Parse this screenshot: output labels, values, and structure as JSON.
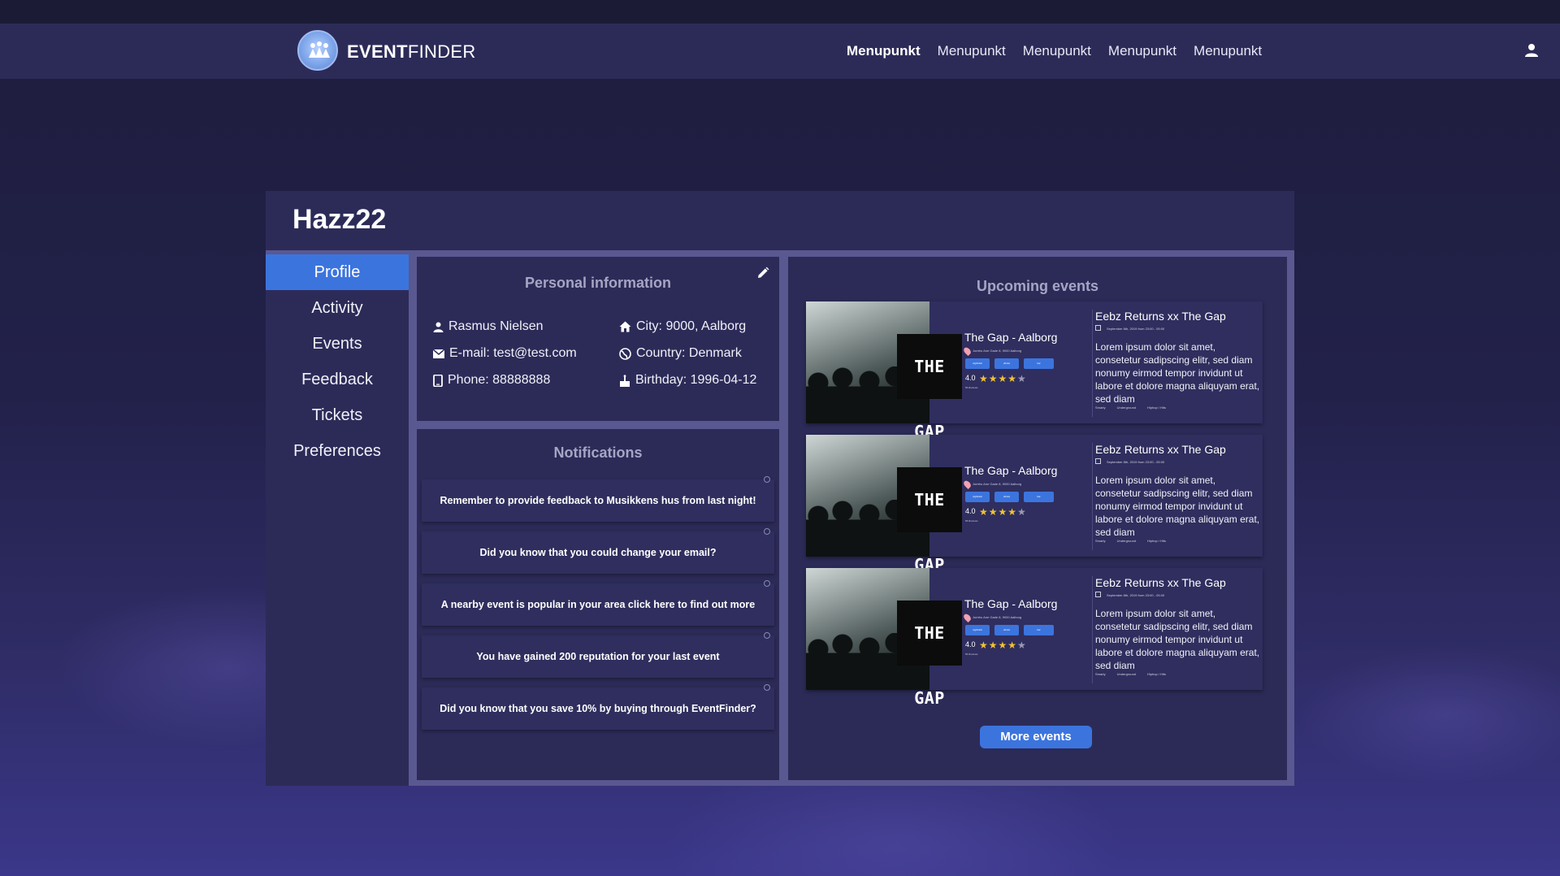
{
  "brand": {
    "bold": "EVENT",
    "light": "FINDER",
    "logo_icon": "people-icon"
  },
  "nav": {
    "items": [
      {
        "label": "Menupunkt",
        "active": true
      },
      {
        "label": "Menupunkt",
        "active": false
      },
      {
        "label": "Menupunkt",
        "active": false
      },
      {
        "label": "Menupunkt",
        "active": false
      },
      {
        "label": "Menupunkt",
        "active": false
      }
    ],
    "user_icon": "user-icon"
  },
  "profile": {
    "username": "Hazz22"
  },
  "sidebar": {
    "items": [
      {
        "label": "Profile",
        "active": true
      },
      {
        "label": "Activity",
        "active": false
      },
      {
        "label": "Events",
        "active": false
      },
      {
        "label": "Feedback",
        "active": false
      },
      {
        "label": "Tickets",
        "active": false
      },
      {
        "label": "Preferences",
        "active": false
      }
    ]
  },
  "personal": {
    "title": "Personal information",
    "name": "Rasmus Nielsen",
    "email": "E-mail: test@test.com",
    "phone": "Phone: 88888888",
    "city": "City: 9000, Aalborg",
    "country": "Country: Denmark",
    "birthday": "Birthday: 1996-04-12"
  },
  "notifications": {
    "title": "Notifications",
    "items": [
      "Remember to provide feedback to Musikkens hus from last night!",
      "Did you know that you could change your email?",
      "A nearby event is popular in your area click here to find out more",
      "You have gained 200 reputation for your last event",
      "Did you know that you save 10% by buying through EventFinder?"
    ]
  },
  "upcoming": {
    "title": "Upcoming events",
    "events": [
      {
        "venue": "The Gap - Aalborg",
        "logo_text": "THE GAP",
        "address": "Jomfru Ane Gade 8, 9000 Aalborg",
        "tags": [
          "nightclub",
          "drinks",
          "bar"
        ],
        "rating": "4.0",
        "stars": 4,
        "reviews": "56 Reviews",
        "title": "Eebz Returns xx The Gap",
        "date": "September 8th, 2019 from 23:00 - 05:00",
        "description": "Lorem ipsum dolor sit amet, consetetur sadipscing elitr, sed diam nonumy eirmod tempor invidunt ut labore et dolore magna aliquyam erat, sed diam",
        "meta": [
          "Smarty",
          "Underground",
          "Hiphop / Hits"
        ]
      },
      {
        "venue": "The Gap - Aalborg",
        "logo_text": "THE GAP",
        "address": "Jomfru Ane Gade 8, 9000 Aalborg",
        "tags": [
          "nightclub",
          "drinks",
          "bar"
        ],
        "rating": "4.0",
        "stars": 4,
        "reviews": "56 Reviews",
        "title": "Eebz Returns xx The Gap",
        "date": "September 8th, 2019 from 23:00 - 05:00",
        "description": "Lorem ipsum dolor sit amet, consetetur sadipscing elitr, sed diam nonumy eirmod tempor invidunt ut labore et dolore magna aliquyam erat, sed diam",
        "meta": [
          "Smarty",
          "Underground",
          "Hiphop / Hits"
        ]
      },
      {
        "venue": "The Gap - Aalborg",
        "logo_text": "THE GAP",
        "address": "Jomfru Ane Gade 8, 9000 Aalborg",
        "tags": [
          "nightclub",
          "drinks",
          "bar"
        ],
        "rating": "4.0",
        "stars": 4,
        "reviews": "56 Reviews",
        "title": "Eebz Returns xx The Gap",
        "date": "September 8th, 2019 from 23:00 - 05:00",
        "description": "Lorem ipsum dolor sit amet, consetetur sadipscing elitr, sed diam nonumy eirmod tempor invidunt ut labore et dolore magna aliquyam erat, sed diam",
        "meta": [
          "Smarty",
          "Underground",
          "Hiphop / Hits"
        ]
      }
    ],
    "more_label": "More events"
  },
  "colors": {
    "accent": "#3c74de",
    "panel": "#2c2b58",
    "divider": "#5a5890",
    "star": "#f1c232"
  }
}
